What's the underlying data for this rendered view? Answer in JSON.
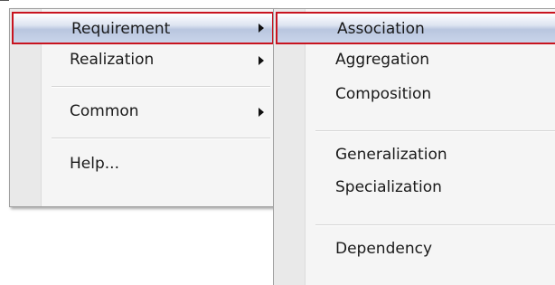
{
  "main_menu": {
    "items": [
      {
        "label": "Requirement",
        "has_submenu": true,
        "highlighted": true
      },
      {
        "label": "Realization",
        "has_submenu": true,
        "highlighted": false
      },
      {
        "label": "Common",
        "has_submenu": true,
        "highlighted": false
      },
      {
        "label": "Help...",
        "has_submenu": false,
        "highlighted": false
      }
    ]
  },
  "sub_menu": {
    "items": [
      {
        "label": "Association",
        "highlighted": true
      },
      {
        "label": "Aggregation",
        "highlighted": false
      },
      {
        "label": "Composition",
        "highlighted": false
      },
      {
        "label": "Generalization",
        "highlighted": false
      },
      {
        "label": "Specialization",
        "highlighted": false
      },
      {
        "label": "Dependency",
        "highlighted": false
      }
    ]
  },
  "colors": {
    "highlight_border": "#c8141f",
    "menu_background": "#f5f5f5",
    "gutter": "#e9e9e9",
    "text": "#1a1a1a"
  },
  "icons": {
    "submenu_arrow": "submenu-arrow-icon"
  }
}
